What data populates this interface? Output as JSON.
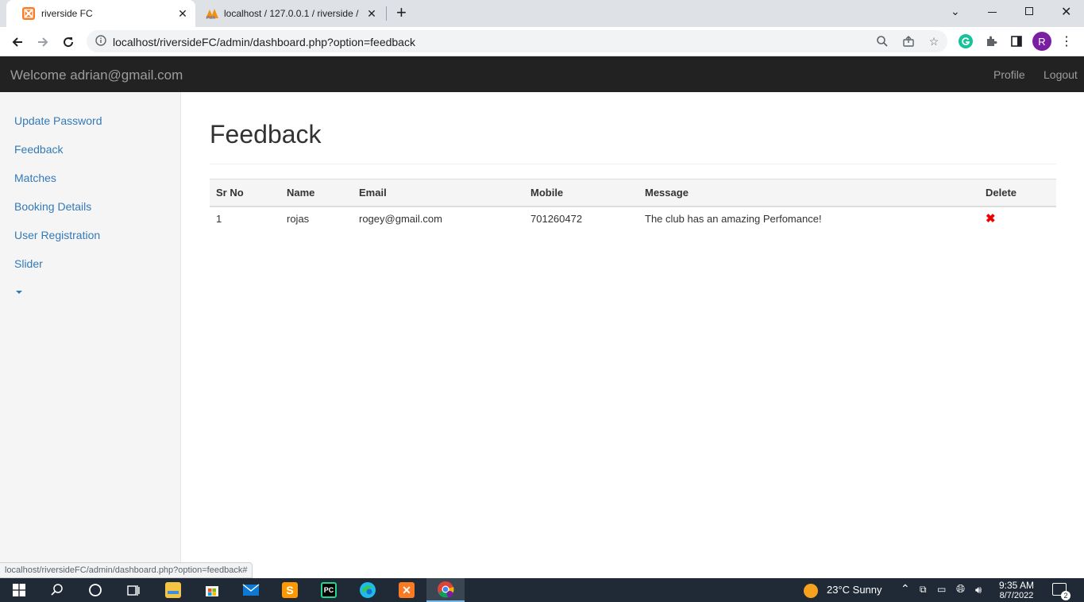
{
  "browser": {
    "tabs": [
      {
        "title": "riverside FC",
        "active": true,
        "favicon": "xampp-icon"
      },
      {
        "title": "localhost / 127.0.0.1 / riverside / ",
        "active": false,
        "favicon": "phpmyadmin-icon"
      }
    ],
    "new_tab": "+",
    "url": "localhost/riversideFC/admin/dashboard.php?option=feedback",
    "profile_initial": "R",
    "status_url": "localhost/riversideFC/admin/dashboard.php?option=feedback#"
  },
  "navbar": {
    "welcome": "Welcome adrian@gmail.com",
    "links": [
      "Profile",
      "Logout"
    ]
  },
  "sidebar": {
    "items": [
      {
        "label": "Update Password"
      },
      {
        "label": "Feedback"
      },
      {
        "label": "Matches"
      },
      {
        "label": "Booking Details"
      },
      {
        "label": "User Registration"
      },
      {
        "label": "Slider"
      }
    ]
  },
  "main": {
    "title": "Feedback",
    "table": {
      "headers": [
        "Sr No",
        "Name",
        "Email",
        "Mobile",
        "Message",
        "Delete"
      ],
      "rows": [
        {
          "sr": "1",
          "name": "rojas",
          "email": "rogey@gmail.com",
          "mobile": "701260472",
          "message": "The club has an amazing Perfomance!",
          "delete_icon": "delete-x-icon"
        }
      ]
    }
  },
  "taskbar": {
    "weather": "23°C  Sunny",
    "time": "9:35 AM",
    "date": "8/7/2022",
    "notification_count": "2"
  },
  "colors": {
    "link": "#337ab7",
    "navbar_bg": "#222222",
    "delete": "#ee0000",
    "taskbar_bg": "#202a36"
  }
}
